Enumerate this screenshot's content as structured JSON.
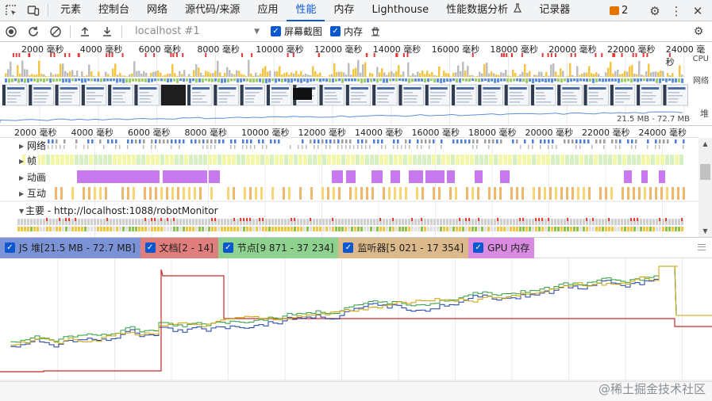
{
  "tabs": [
    "元素",
    "控制台",
    "网络",
    "源代码/来源",
    "应用",
    "性能",
    "内存",
    "Lighthouse",
    "性能数据分析"
  ],
  "active_tab": "性能",
  "tab_recorder": "记录器",
  "issues_count": "2",
  "toolbar": {
    "target": "localhost #1",
    "screenshots_label": "屏幕截图",
    "memory_label": "内存"
  },
  "overview": {
    "ruler_labels": [
      "2000 毫秒",
      "4000 毫秒",
      "6000 毫秒",
      "8000 毫秒",
      "10000 毫秒",
      "12000 毫秒",
      "14000 毫秒",
      "16000 毫秒",
      "18000 毫秒",
      "20000 毫秒",
      "22000 毫秒",
      "24000 毫秒"
    ],
    "cpu_label": "CPU",
    "net_label": "网络",
    "heap_label": "堆",
    "heap_range": "21.5 MB - 72.7 MB"
  },
  "flame": {
    "ruler_labels": [
      "2000 毫秒",
      "4000 毫秒",
      "6000 毫秒",
      "8000 毫秒",
      "10000 毫秒",
      "12000 毫秒",
      "14000 毫秒",
      "16000 毫秒",
      "18000 毫秒",
      "20000 毫秒",
      "22000 毫秒",
      "24000 毫秒"
    ],
    "tracks": [
      "网络",
      "帧",
      "动画",
      "互动"
    ],
    "main_label": "主要 - http://localhost:1088/robotMonitor"
  },
  "legend": [
    {
      "label": "JS 堆[21.5 MB - 72.7 MB]",
      "color": "#7b93d6"
    },
    {
      "label": "文档[2 - 14]",
      "color": "#e07d7d"
    },
    {
      "label": "节点[9 871 - 37 234]",
      "color": "#8fd18f"
    },
    {
      "label": "监听器[5 021 - 17 354]",
      "color": "#dcb98a"
    },
    {
      "label": "GPU 内存",
      "color": "#d88be0"
    }
  ],
  "colors": {
    "js_heap": "#1a3fa8",
    "documents": "#c62828",
    "nodes": "#2e9e3e",
    "listeners": "#c8a000"
  },
  "watermark": "@稀土掘金技术社区"
}
